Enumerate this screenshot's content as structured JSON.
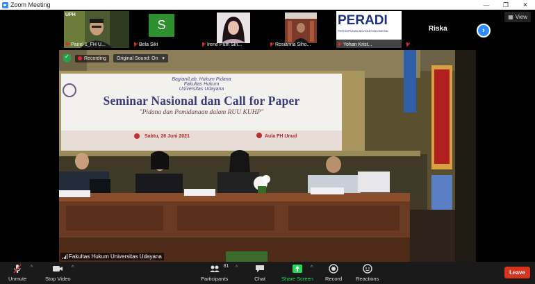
{
  "window": {
    "title": "Zoom Meeting",
    "minimize": "—",
    "restore": "❐",
    "close": "✕"
  },
  "strip": {
    "participants": [
      {
        "name": "Panel 1_FH U...",
        "badge": "UPH"
      },
      {
        "name": "Bela Siki",
        "initial": "S"
      },
      {
        "name": "Irene Putri Sin..."
      },
      {
        "name": "Rosianna Siho..."
      },
      {
        "name": "Yohan Krist...",
        "logo_text": "PERADI",
        "logo_sub": "PERHIMPUNAN ADVOKAT INDONESIA"
      },
      {
        "name": "Riska"
      }
    ],
    "view_label": "View"
  },
  "stage": {
    "recording_label": "Recording",
    "original_sound_label": "Original Sound: On",
    "speaker_name": "Fakultas Hukum Universitas Udayana",
    "banner": {
      "line1": "Bagian/Lab. Hukum Pidana",
      "line2": "Fakultas Hukum",
      "line3": "Universitas Udayana",
      "title": "Seminar Nasional dan Call for Paper",
      "subtitle": "\"Pidana dan Pemidanaan dalam RUU KUHP\"",
      "date": "Sabtu, 26 Juni 2021",
      "place": "Aula FH Unud"
    }
  },
  "toolbar": {
    "unmute": "Unmute",
    "stop_video": "Stop Video",
    "participants": "Participants",
    "participants_count": "81",
    "chat": "Chat",
    "share_screen": "Share Screen",
    "record": "Record",
    "reactions": "Reactions",
    "leave": "Leave"
  },
  "colors": {
    "accent": "#2d8cff",
    "share_green": "#23d959",
    "leave_red": "#d6341c",
    "recording_red": "#ee2233"
  }
}
